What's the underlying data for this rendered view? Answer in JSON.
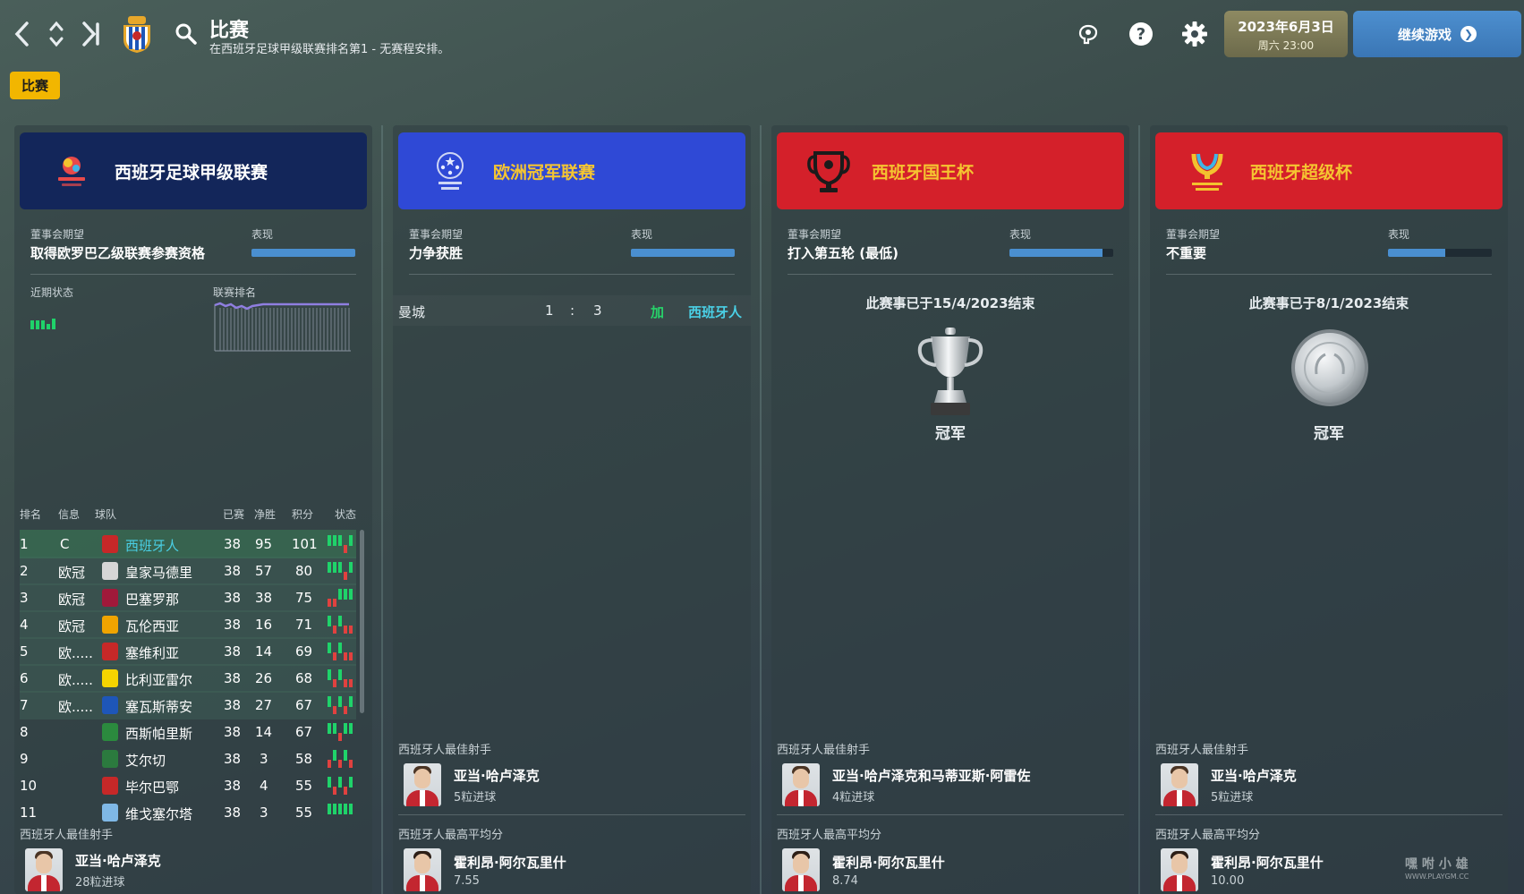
{
  "header": {
    "title": "比赛",
    "subtitle": "在西班牙足球甲级联赛排名第1 - 无赛程安排。",
    "date_line1": "2023年6月3日",
    "date_line2": "周六 23:00",
    "continue_label": "继续游戏"
  },
  "tabs": {
    "matches": "比赛"
  },
  "labels": {
    "board_expectation": "董事会期望",
    "performance": "表现",
    "recent_form": "近期状态",
    "league_position": "联赛排名",
    "top_scorer": "西班牙人最佳射手",
    "best_avg_rating": "西班牙人最高平均分",
    "winner": "冠军"
  },
  "league": {
    "name": "西班牙足球甲级联赛",
    "expectation": "取得欧罗巴乙级联赛参赛资格",
    "performance": 1.0,
    "columns": [
      "排名",
      "信息",
      "球队",
      "已赛",
      "净胜",
      "积分",
      "状态"
    ],
    "rows": [
      {
        "pos": "1",
        "info": "C",
        "team": "西班牙人",
        "played": "38",
        "gd": "95",
        "pts": "101"
      },
      {
        "pos": "2",
        "info": "欧冠",
        "team": "皇家马德里",
        "played": "38",
        "gd": "57",
        "pts": "80"
      },
      {
        "pos": "3",
        "info": "欧冠",
        "team": "巴塞罗那",
        "played": "38",
        "gd": "38",
        "pts": "75"
      },
      {
        "pos": "4",
        "info": "欧冠",
        "team": "瓦伦西亚",
        "played": "38",
        "gd": "16",
        "pts": "71"
      },
      {
        "pos": "5",
        "info": "欧.....",
        "team": "塞维利亚",
        "played": "38",
        "gd": "14",
        "pts": "69"
      },
      {
        "pos": "6",
        "info": "欧.....",
        "team": "比利亚雷尔",
        "played": "38",
        "gd": "26",
        "pts": "68"
      },
      {
        "pos": "7",
        "info": "欧.....",
        "team": "塞瓦斯蒂安",
        "played": "38",
        "gd": "27",
        "pts": "67"
      },
      {
        "pos": "8",
        "info": "",
        "team": "西斯帕里斯",
        "played": "38",
        "gd": "14",
        "pts": "67"
      },
      {
        "pos": "9",
        "info": "",
        "team": "艾尔切",
        "played": "38",
        "gd": "3",
        "pts": "58"
      },
      {
        "pos": "10",
        "info": "",
        "team": "毕尔巴鄂",
        "played": "38",
        "gd": "4",
        "pts": "55"
      },
      {
        "pos": "11",
        "info": "",
        "team": "维戈塞尔塔",
        "played": "38",
        "gd": "3",
        "pts": "55"
      }
    ],
    "top_scorer": {
      "name": "亚当·哈卢泽克",
      "detail": "28粒进球"
    }
  },
  "ucl": {
    "name": "欧洲冠军联赛",
    "expectation": "力争获胜",
    "performance": 1.0,
    "match": {
      "home": "曼城",
      "home_score": "1",
      "sep": ":",
      "away_score": "3",
      "extra": "加",
      "away": "西班牙人"
    },
    "top_scorer": {
      "name": "亚当·哈卢泽克",
      "detail": "5粒进球"
    },
    "best_rating": {
      "name": "霍利昂·阿尔瓦里什",
      "detail": "7.55"
    }
  },
  "copa": {
    "name": "西班牙国王杯",
    "expectation": "打入第五轮 (最低)",
    "performance": 0.9,
    "ended": "此赛事已于15/4/2023结束",
    "top_scorer": {
      "name": "亚当·哈卢泽克和马蒂亚斯·阿雷佐",
      "detail": "4粒进球"
    },
    "best_rating": {
      "name": "霍利昂·阿尔瓦里什",
      "detail": "8.74"
    }
  },
  "supercopa": {
    "name": "西班牙超级杯",
    "expectation": "不重要",
    "performance": 0.55,
    "ended": "此赛事已于8/1/2023结束",
    "top_scorer": {
      "name": "亚当·哈卢泽克",
      "detail": "5粒进球"
    },
    "best_rating": {
      "name": "霍利昂·阿尔瓦里什",
      "detail": "10.00"
    }
  },
  "colors": {
    "league_header": "#13265a",
    "ucl_header": "#2f49d6",
    "copa_header": "#d4202a",
    "supercopa_header": "#d4202a",
    "accent_yellow": "#f2b600",
    "highlight_team": "#4ad0e6"
  },
  "watermark": {
    "main": "嘿 咐 小 雄",
    "sub": "WWW.PLAYGM.CC"
  }
}
